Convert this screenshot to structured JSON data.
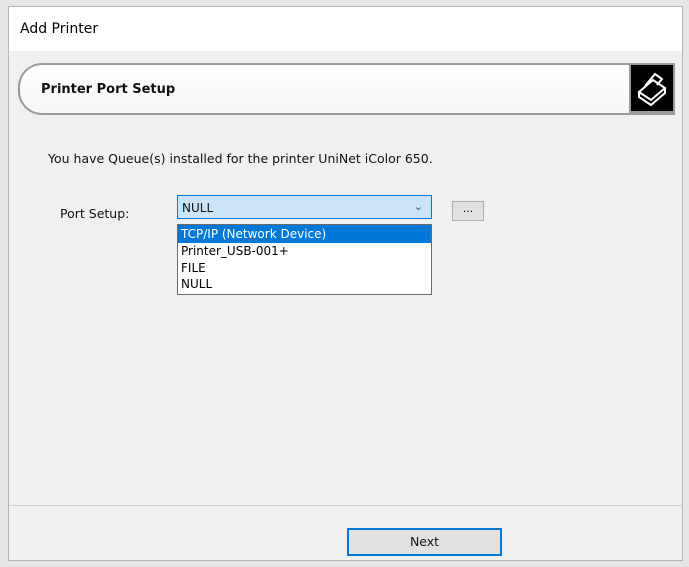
{
  "window": {
    "title": "Add Printer"
  },
  "banner": {
    "title": "Printer Port Setup",
    "icon": "printer-icon"
  },
  "message": "You have Queue(s) installed for the printer UniNet iColor 650.",
  "port_setup": {
    "label": "Port Setup:",
    "selected": "NULL",
    "options": [
      "TCP/IP (Network Device)",
      "Printer_USB-001+",
      "FILE",
      "NULL"
    ],
    "highlighted_index": 0,
    "browse_label": "..."
  },
  "footer": {
    "next_label": "Next"
  },
  "colors": {
    "accent": "#0078d7",
    "select_bg": "#cce4f7"
  }
}
